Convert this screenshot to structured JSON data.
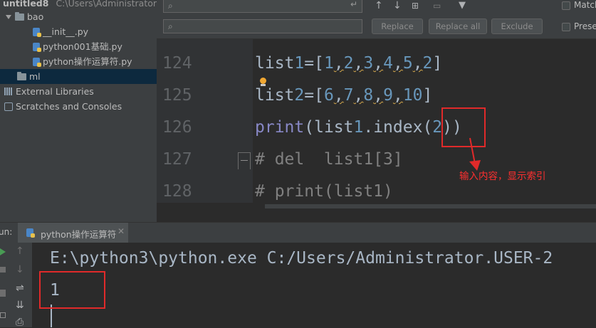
{
  "project": {
    "root_label": "untitled8",
    "root_path": "C:\\Users\\Administrator",
    "items": [
      {
        "label": "bao"
      },
      {
        "label": "__init__.py"
      },
      {
        "label": "python001基础.py"
      },
      {
        "label": "python操作运算符.py"
      },
      {
        "label": "ml"
      },
      {
        "label": "External Libraries"
      },
      {
        "label": "Scratches and Consoles"
      }
    ]
  },
  "search": {
    "find_value": "",
    "replace_value": "",
    "replace_label": "Replace",
    "replace_all_label": "Replace all",
    "exclude_label": "Exclude",
    "match_label": "Match",
    "preserve_label": "Preser"
  },
  "editor": {
    "line_numbers": [
      "124",
      "125",
      "126",
      "127",
      "128"
    ],
    "lines": [
      "list1=[1,2,3,4,5,2]",
      "list2=[6,7,8,9,10]",
      "print(list1.index(2))",
      "# del  list1[3]",
      "# print(list1)"
    ]
  },
  "run": {
    "tab_label": "un:",
    "config_label": "python操作运算符",
    "command": "E:\\python3\\python.exe C:/Users/Administrator.USER-2",
    "output": "1"
  },
  "annotation": {
    "text": "输入内容，显示索引"
  },
  "colors": {
    "keyword": "#8888c6",
    "number": "#6897bb",
    "comment": "#808080",
    "annotation_red": "#e02a2a"
  }
}
